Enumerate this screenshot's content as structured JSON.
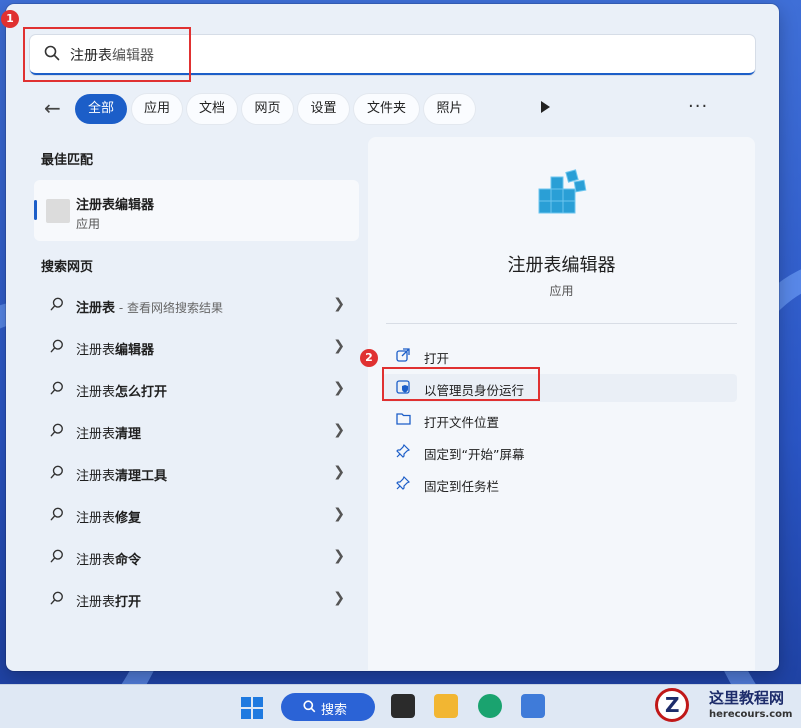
{
  "search": {
    "query_plain": "注册表",
    "query_selected": "编辑器"
  },
  "filters": {
    "back_icon": "arrow-left-icon",
    "chips": [
      "全部",
      "应用",
      "文档",
      "网页",
      "设置",
      "文件夹",
      "照片"
    ],
    "more_label": "···"
  },
  "best_match": {
    "heading": "最佳匹配",
    "name": "注册表编辑器",
    "type": "应用"
  },
  "web_search": {
    "heading": "搜索网页",
    "items": [
      {
        "bold": "注册表",
        "rest": "",
        "hint": " - 查看网络搜索结果"
      },
      {
        "bold": "注册表",
        "rest": "编辑器",
        "hint": ""
      },
      {
        "bold": "注册表",
        "rest": "怎么打开",
        "hint": ""
      },
      {
        "bold": "注册表",
        "rest": "清理",
        "hint": ""
      },
      {
        "bold": "注册表",
        "rest": "清理工具",
        "hint": ""
      },
      {
        "bold": "注册表",
        "rest": "修复",
        "hint": ""
      },
      {
        "bold": "注册表",
        "rest": "命令",
        "hint": ""
      },
      {
        "bold": "注册表",
        "rest": "打开",
        "hint": ""
      }
    ]
  },
  "details": {
    "app_name": "注册表编辑器",
    "app_type": "应用",
    "actions": [
      {
        "label": "打开",
        "icon": "open-external-icon"
      },
      {
        "label": "以管理员身份运行",
        "icon": "shield-admin-icon"
      },
      {
        "label": "打开文件位置",
        "icon": "folder-icon"
      },
      {
        "label": "固定到“开始”屏幕",
        "icon": "pin-icon"
      },
      {
        "label": "固定到任务栏",
        "icon": "pin-icon"
      }
    ]
  },
  "annotations": {
    "marker_1": "1",
    "marker_2": "2",
    "color": "#e03131"
  },
  "taskbar": {
    "search_label": "搜索"
  },
  "watermark": {
    "title": "这里教程网",
    "site": "herecours.com",
    "logo_letter": "Z"
  },
  "colors": {
    "accent": "#1c5ec8",
    "panel": "#eaf0f8"
  }
}
